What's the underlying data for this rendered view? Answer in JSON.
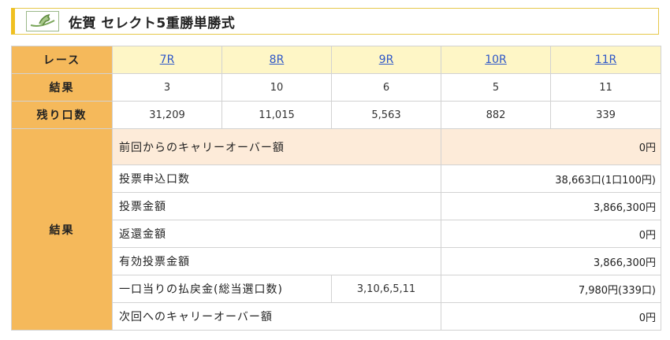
{
  "header": {
    "logo_icon": "horse-logo-icon",
    "title": "佐賀 セレクト5重勝単勝式"
  },
  "table": {
    "race_label": "レース",
    "races": [
      "7R",
      "8R",
      "9R",
      "10R",
      "11R"
    ],
    "result_label": "結果",
    "results": [
      "3",
      "10",
      "6",
      "5",
      "11"
    ],
    "remaining_label": "残り口数",
    "remaining": [
      "31,209",
      "11,015",
      "5,563",
      "882",
      "339"
    ],
    "summary_label": "結果",
    "summary": [
      {
        "label": "前回からのキャリーオーバー額",
        "value": "0円"
      },
      {
        "label": "投票申込口数",
        "value": "38,663口(1口100円)"
      },
      {
        "label": "投票金額",
        "value": "3,866,300円"
      },
      {
        "label": "返還金額",
        "value": "0円"
      },
      {
        "label": "有効投票金額",
        "value": "3,866,300円"
      },
      {
        "label": "一口当りの払戻金(総当選口数)",
        "combo": "3,10,6,5,11",
        "value": "7,980円(339口)"
      },
      {
        "label": "次回へのキャリーオーバー額",
        "value": "0円"
      }
    ]
  },
  "colors": {
    "label_bg": "#f5b95b",
    "race_header_bg": "#fef6c6",
    "carryover_bg": "#fdebd9",
    "link": "#2f57c8",
    "accent": "#f0c020"
  }
}
